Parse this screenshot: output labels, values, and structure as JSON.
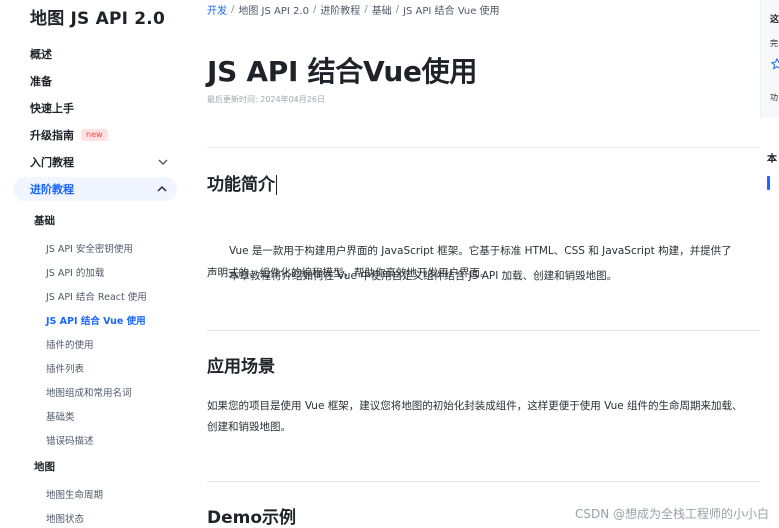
{
  "sidebar": {
    "logo": "地图 JS API 2.0",
    "items": [
      {
        "label": "概述"
      },
      {
        "label": "准备"
      },
      {
        "label": "快速上手"
      },
      {
        "label": "升级指南",
        "badge": "new"
      },
      {
        "label": "入门教程"
      },
      {
        "label": "进阶教程"
      }
    ],
    "groups": [
      {
        "label": "基础",
        "items": [
          "JS API 安全密钥使用",
          "JS API 的加载",
          "JS API 结合 React 使用",
          "JS API 结合 Vue 使用",
          "插件的使用",
          "插件列表",
          "地图组成和常用名词",
          "基础类",
          "错误码描述"
        ]
      },
      {
        "label": "地图",
        "items": [
          "地图生命周期",
          "地图状态"
        ]
      }
    ]
  },
  "breadcrumb": [
    "开发",
    "地图 JS API 2.0",
    "进阶教程",
    "基础",
    "JS API 结合 Vue 使用"
  ],
  "breadcrumb_sep": "/",
  "main": {
    "title": "JS API 结合Vue使用",
    "updated": "最后更新时间: 2024年04月26日",
    "sections": [
      {
        "title": "功能简介",
        "paragraphs": [
          "Vue 是一款用于构建用户界面的 JavaScript 框架。它基于标准 HTML、CSS 和 JavaScript 构建，并提供了",
          "声明式的、组件化的编程模型，帮助你高效地开发用户界面。",
          "本章教程将介绍如何在 Vue 中使用自定义组件结合 JS API 加载、创建和销毁地图。"
        ]
      },
      {
        "title": "应用场景",
        "paragraphs": [
          "如果您的项目是使用 Vue 框架，建议您将地图的初始化封装成组件，这样更便于使用 Vue 组件的生命周期来加载、",
          "创建和销毁地图。"
        ]
      },
      {
        "title": "Demo示例"
      }
    ]
  },
  "rail": {
    "line1": "这",
    "line2": "完",
    "line3": "功",
    "toc": "本"
  },
  "watermark": "CSDN @想成为全栈工程师的小小白",
  "colors": {
    "accent": "#1a66ff",
    "badge_bg": "#ffe1e1",
    "badge_text": "#f04848",
    "active_bg": "#f0f5ff"
  }
}
